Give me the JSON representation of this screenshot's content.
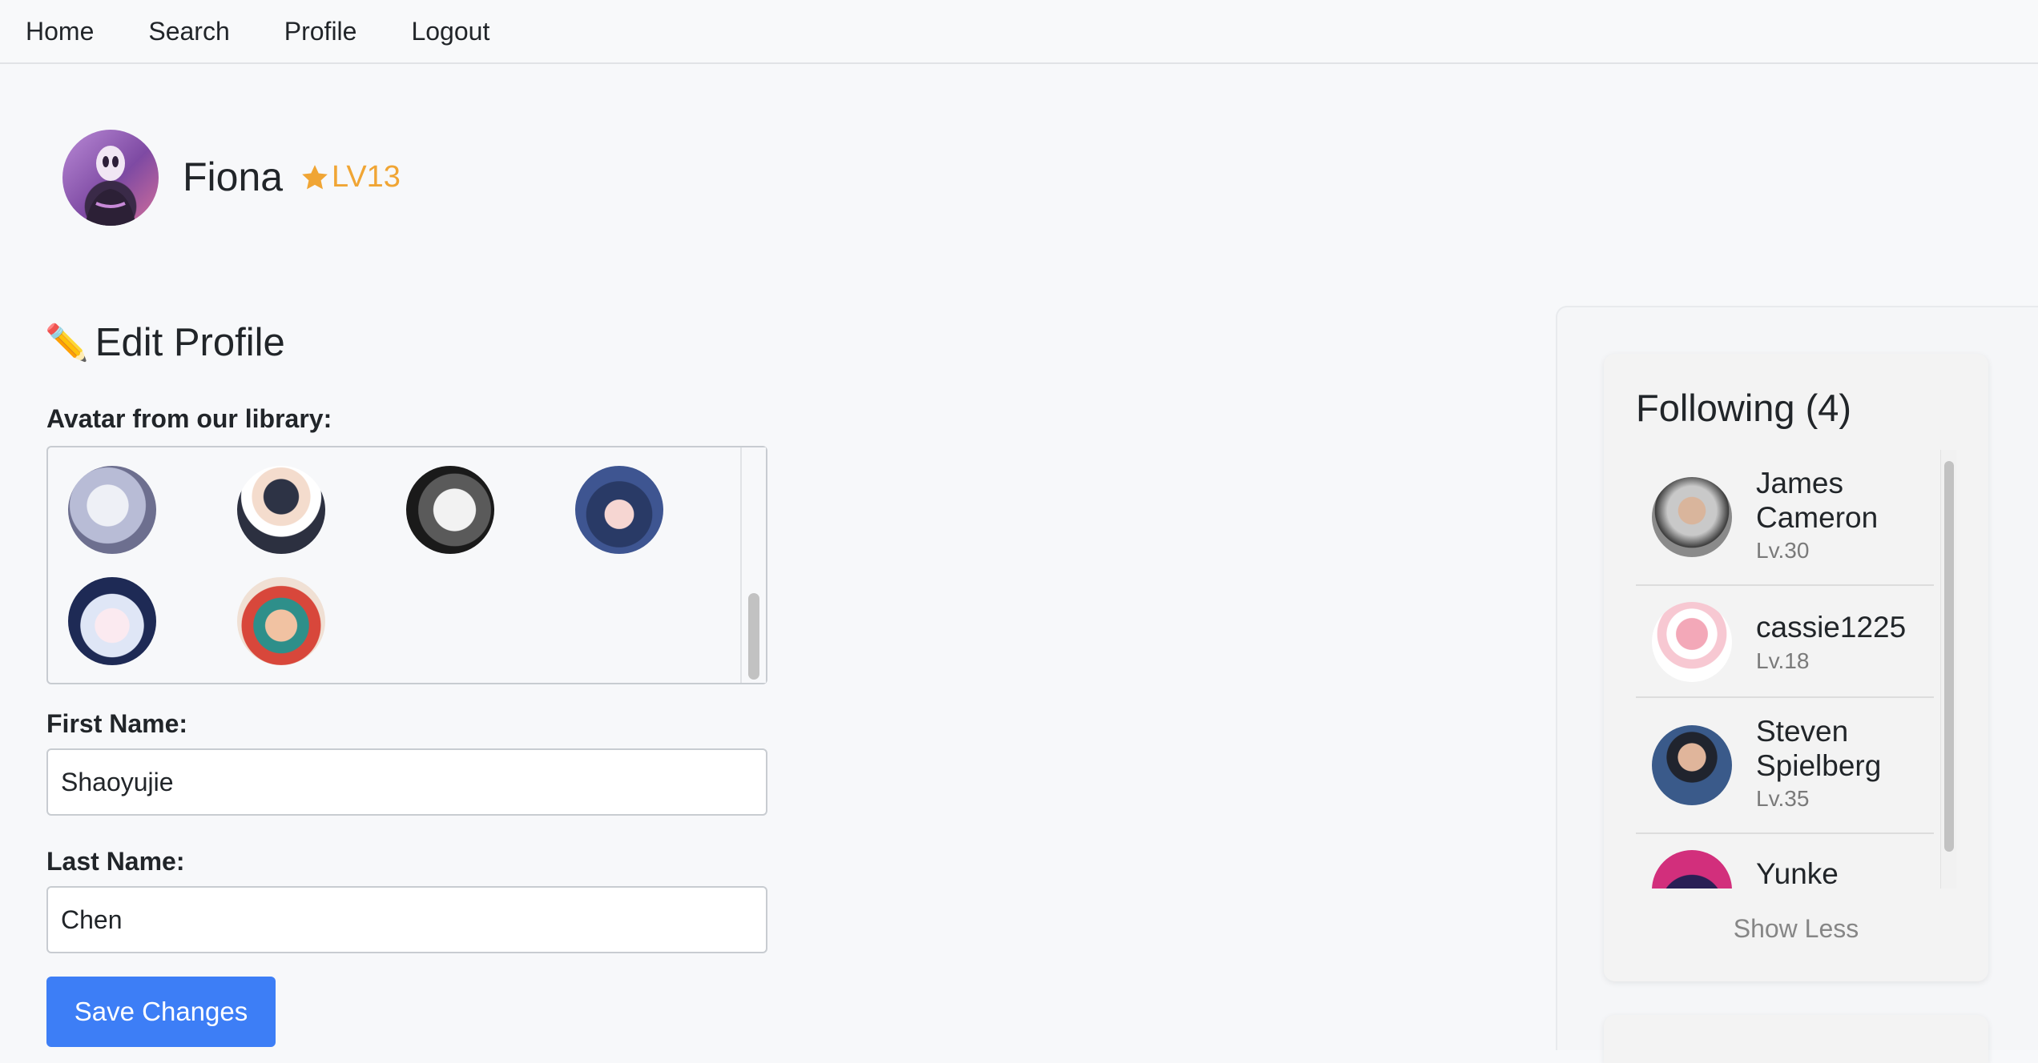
{
  "nav": {
    "items": [
      {
        "label": "Home"
      },
      {
        "label": "Search"
      },
      {
        "label": "Profile"
      },
      {
        "label": "Logout"
      }
    ]
  },
  "user": {
    "name": "Fiona",
    "level": "LV13"
  },
  "edit": {
    "title": "Edit Profile",
    "avatar_label": "Avatar from our library:",
    "first_name_label": "First Name:",
    "first_name_value": "Shaoyujie",
    "last_name_label": "Last Name:",
    "last_name_value": "Chen",
    "save_label": "Save Changes"
  },
  "following": {
    "title": "Following (4)",
    "items": [
      {
        "name": "James Cameron",
        "level": "Lv.30"
      },
      {
        "name": "cassie1225",
        "level": "Lv.18"
      },
      {
        "name": "Steven Spielberg",
        "level": "Lv.35"
      },
      {
        "name": "Yunke",
        "level": ""
      }
    ],
    "show_less": "Show Less"
  },
  "colors": {
    "accent": "#3d7ef6",
    "level": "#f0a534"
  }
}
